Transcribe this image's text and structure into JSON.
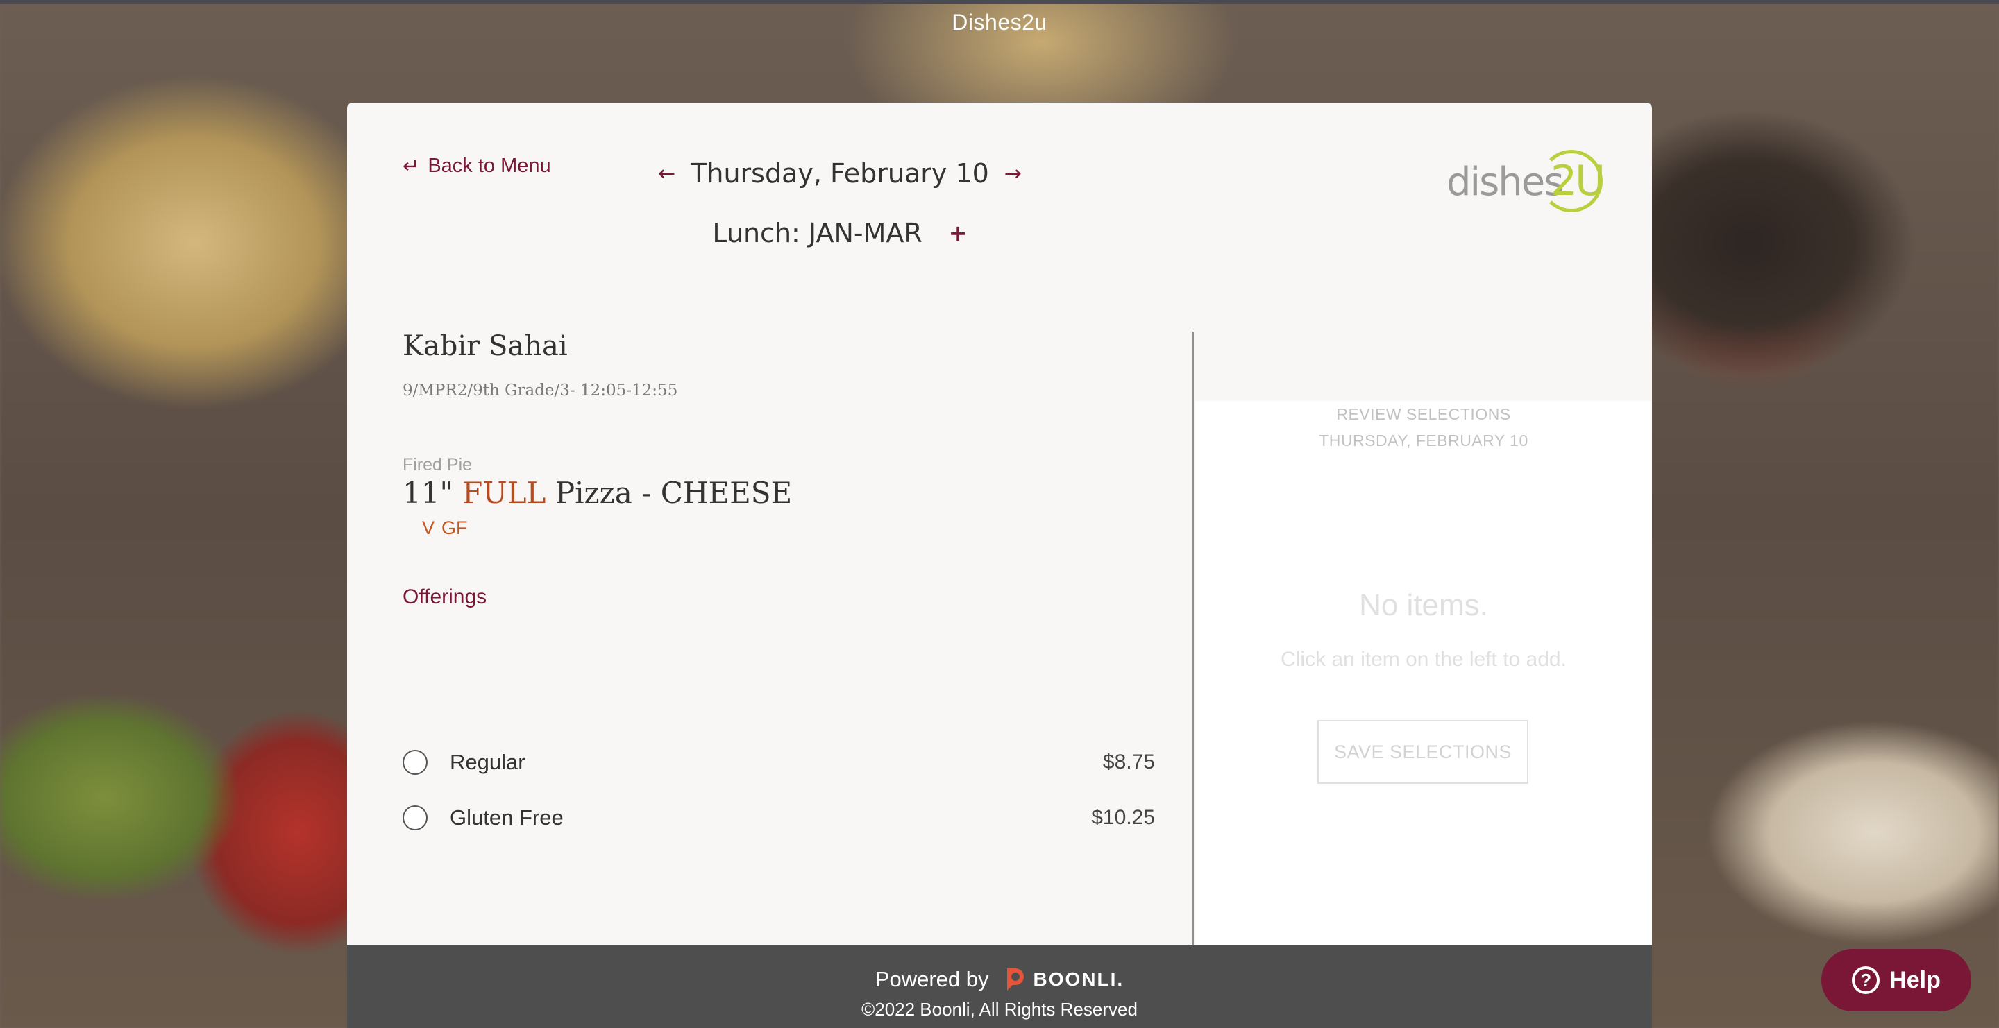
{
  "site": {
    "title": "Dishes2u"
  },
  "nav": {
    "back_label": "Back to Menu",
    "back_icon": "↵",
    "prev_icon": "←",
    "next_icon": "→",
    "date": "Thursday, February 10",
    "meal": "Lunch: JAN-MAR",
    "add_icon": "+"
  },
  "logo": {
    "part1": "dishes",
    "part2": "2U"
  },
  "student": {
    "name": "Kabir Sahai",
    "details": "9/MPR2/9th Grade/3- 12:05-12:55"
  },
  "item": {
    "category": "Fired Pie",
    "title_prefix": "11\"",
    "title_highlight": "FULL",
    "title_suffix": "Pizza - CHEESE",
    "tags": [
      "V",
      "GF"
    ]
  },
  "offerings": {
    "label": "Offerings",
    "options": [
      {
        "label": "Regular",
        "price": "$8.75",
        "selected": false
      },
      {
        "label": "Gluten Free",
        "price": "$10.25",
        "selected": false
      }
    ]
  },
  "review": {
    "heading": "REVIEW SELECTIONS",
    "date": "THURSDAY, FEBRUARY 10",
    "empty_title": "No items.",
    "empty_hint": "Click an item on the left to add.",
    "save_label": "SAVE SELECTIONS"
  },
  "footer": {
    "powered_label": "Powered by",
    "brand": "BOONLI.",
    "copyright": "©2022 Boonli, All Rights Reserved"
  },
  "help": {
    "label": "Help",
    "icon": "?"
  },
  "colors": {
    "accent": "#7a1636",
    "highlight": "#b64a20",
    "tag": "#c4541e",
    "logo_green": "#b9cf3d",
    "footer_bg": "#4e4e4e"
  }
}
